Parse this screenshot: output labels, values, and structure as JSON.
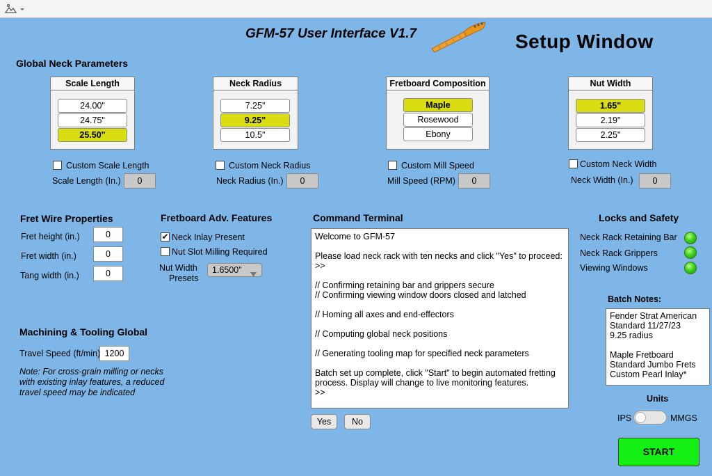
{
  "header": {
    "app_title": "GFM-57 User Interface V1.7",
    "window_title": "Setup Window"
  },
  "global": {
    "title": "Global Neck Parameters",
    "scale": {
      "title": "Scale Length",
      "options": [
        "24.00\"",
        "24.75\"",
        "25.50\""
      ],
      "selected_index": 2,
      "custom_label": "Custom Scale Length",
      "custom_checked": false,
      "field_label": "Scale Length (In.)",
      "field_value": "0"
    },
    "radius": {
      "title": "Neck Radius",
      "options": [
        "7.25\"",
        "9.25\"",
        "10.5\""
      ],
      "selected_index": 1,
      "custom_label": "Custom Neck Radius",
      "custom_checked": false,
      "field_label": "Neck Radius (In.)",
      "field_value": "0"
    },
    "fretboard": {
      "title": "Fretboard Composition",
      "options": [
        "Maple",
        "Rosewood",
        "Ebony"
      ],
      "selected_index": 0,
      "custom_label": "Custom Mill Speed",
      "custom_checked": false,
      "field_label": "Mill Speed (RPM)",
      "field_value": "0"
    },
    "nut": {
      "title": "Nut Width",
      "options": [
        "1.65\"",
        "2.19\"",
        "2.25\""
      ],
      "selected_index": 0,
      "custom_label": "Custom Neck Width",
      "custom_checked": false,
      "field_label": "Neck Width (In.)",
      "field_value": "0"
    }
  },
  "fret_wire": {
    "title": "Fret Wire Properties",
    "height_label": "Fret height (in.)",
    "height_value": "0",
    "width_label": "Fret width (in.)",
    "width_value": "0",
    "tang_label": "Tang width (in.)",
    "tang_value": "0"
  },
  "adv": {
    "title": "Fretboard Adv. Features",
    "inlay_label": "Neck Inlay Present",
    "inlay_checked": true,
    "slot_label": "Nut Slot Milling Required",
    "slot_checked": false,
    "preset_label_1": "Nut Width",
    "preset_label_2": "Presets",
    "preset_value": "1.6500\""
  },
  "machining": {
    "title": "Machining & Tooling Global",
    "speed_label": "Travel Speed (ft/min)",
    "speed_value": "1200",
    "note": "Note: For cross-grain milling or necks with existing inlay features, a reduced travel speed may be indicated"
  },
  "terminal": {
    "title": "Command Terminal",
    "text": "Welcome to GFM-57\n\nPlease load neck rack with ten necks and click \"Yes\" to proceed:\n>>\n\n// Confirming retaining bar and grippers secure\n// Confirming viewing window doors closed and latched\n\n// Homing all axes and end-effectors\n\n// Computing global neck positions\n\n// Generating tooling map for specified neck parameters\n\nBatch set up complete, click \"Start\" to begin automated fretting process. Display will change to live monitoring features.\n>>",
    "yes_label": "Yes",
    "no_label": "No"
  },
  "locks": {
    "title": "Locks and Safety",
    "items": [
      "Neck Rack Retaining Bar",
      "Neck Rack Grippers",
      "Viewing Windows"
    ],
    "status_color": "#3fd21a"
  },
  "batch": {
    "title": "Batch Notes:",
    "text": "Fender Strat American Standard 11/27/23\n9.25 radius\n\nMaple Fretboard\nStandard Jumbo Frets\nCustom Pearl Inlay*"
  },
  "units": {
    "title": "Units",
    "left": "IPS",
    "right": "MMGS",
    "selected": "IPS"
  },
  "start_label": "START",
  "colors": {
    "background": "#7eb6e8",
    "selected": "#d9dd11",
    "start": "#14f014"
  }
}
